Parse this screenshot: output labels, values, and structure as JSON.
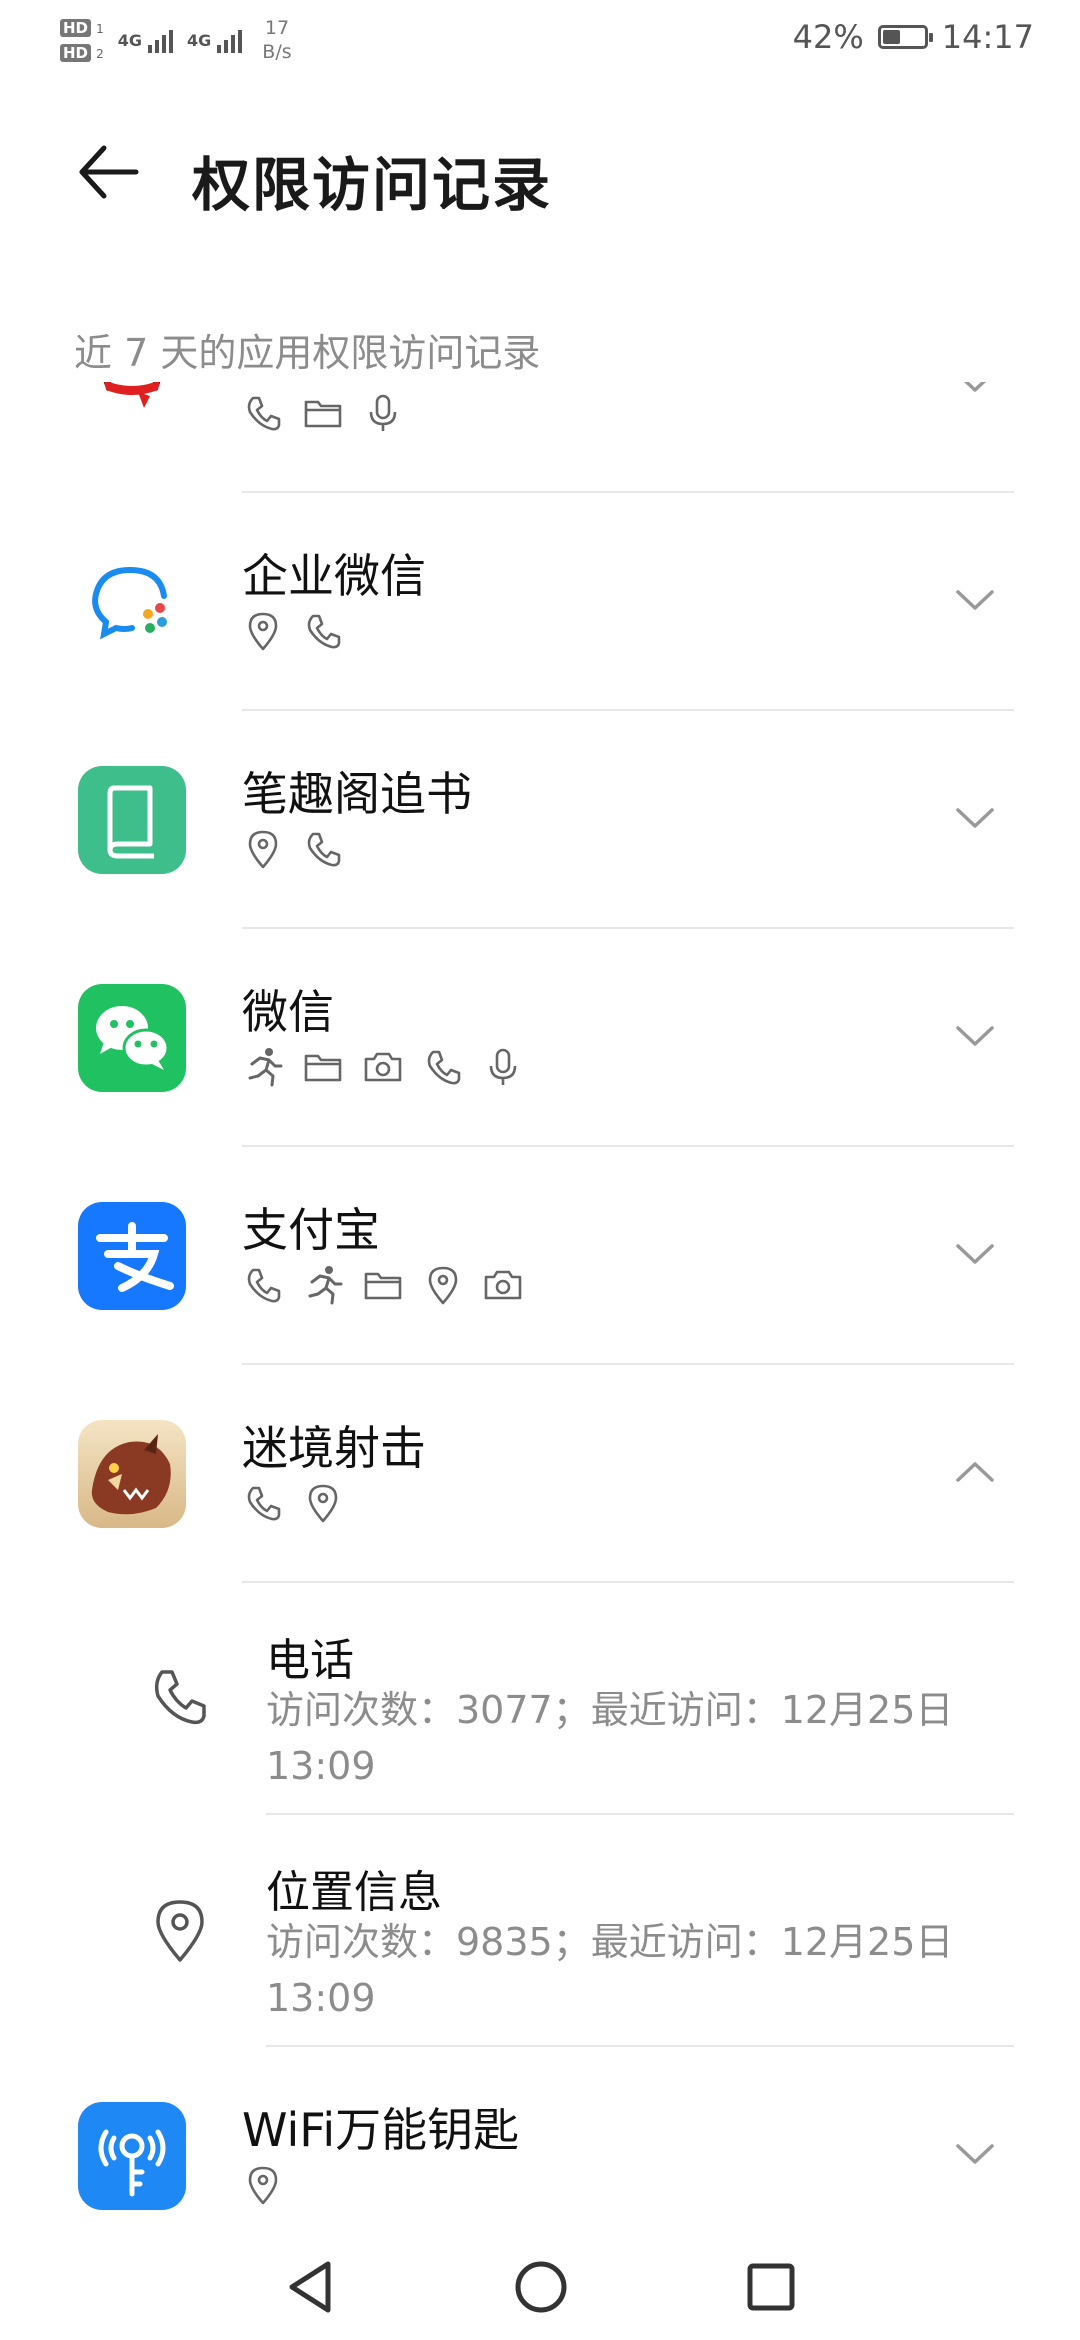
{
  "status_bar": {
    "sim1": "HD",
    "sim1_slot": "1",
    "sim2": "HD",
    "sim2_slot": "2",
    "network1": "4G",
    "network2": "4G",
    "speed_value": "17",
    "speed_unit": "B/s",
    "battery_percent": "42%",
    "battery_level": 0.42,
    "time": "14:17"
  },
  "header": {
    "title": "权限访问记录",
    "subtitle": "近 7 天的应用权限访问记录"
  },
  "apps": [
    {
      "name": "",
      "icon": "qq-penguin-icon",
      "perms": [
        "phone-icon",
        "folder-icon",
        "microphone-icon"
      ],
      "expanded": false
    },
    {
      "name": "企业微信",
      "icon": "wecom-icon",
      "perms": [
        "location-icon",
        "phone-icon"
      ],
      "expanded": false
    },
    {
      "name": "笔趣阁追书",
      "icon": "book-icon",
      "perms": [
        "location-icon",
        "phone-icon"
      ],
      "expanded": false
    },
    {
      "name": "微信",
      "icon": "wechat-icon",
      "perms": [
        "activity-icon",
        "folder-icon",
        "camera-icon",
        "phone-icon",
        "microphone-icon"
      ],
      "expanded": false
    },
    {
      "name": "支付宝",
      "icon": "alipay-icon",
      "perms": [
        "phone-icon",
        "activity-icon",
        "folder-icon",
        "location-icon",
        "camera-icon"
      ],
      "expanded": false
    },
    {
      "name": "迷境射击",
      "icon": "game-dragon-icon",
      "perms": [
        "phone-icon",
        "location-icon"
      ],
      "expanded": true
    },
    {
      "name": "WiFi万能钥匙",
      "icon": "wifi-key-icon",
      "perms": [
        "location-icon"
      ],
      "expanded": false
    }
  ],
  "details": [
    {
      "name": "电话",
      "icon": "phone-icon",
      "meta": "访问次数：3077；最近访问：12月25日 13:09"
    },
    {
      "name": "位置信息",
      "icon": "location-icon",
      "meta": "访问次数：9835；最近访问：12月25日 13:09"
    }
  ],
  "colors": {
    "icon_stroke": "#666666",
    "book_green": "#3dbe8a",
    "wechat_green": "#1fc160",
    "alipay_blue": "#1677ff",
    "wifi_blue": "#1e88f5"
  }
}
